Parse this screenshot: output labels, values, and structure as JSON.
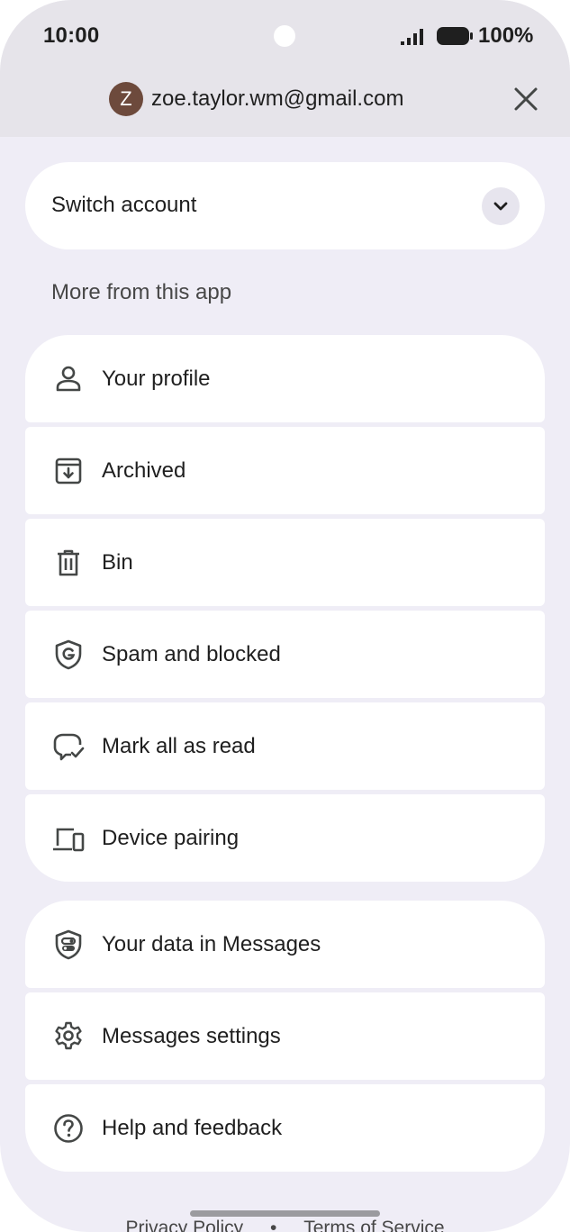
{
  "status_bar": {
    "time": "10:00",
    "battery_percent": "100%",
    "signal_icon": "cellular-signal-icon",
    "battery_icon": "battery-full-icon"
  },
  "account": {
    "avatar_initial": "Z",
    "avatar_color": "#6d4a3c",
    "email": "zoe.taylor.wm@gmail.com",
    "close_icon": "close-icon"
  },
  "switch_account": {
    "label": "Switch account",
    "icon": "chevron-down-icon"
  },
  "section_label": "More from this app",
  "menu_group_1": [
    {
      "label": "Your profile",
      "icon": "person-icon"
    },
    {
      "label": "Archived",
      "icon": "archive-icon"
    },
    {
      "label": "Bin",
      "icon": "trash-icon"
    },
    {
      "label": "Spam and blocked",
      "icon": "shield-g-icon"
    },
    {
      "label": "Mark all as read",
      "icon": "chat-check-icon"
    },
    {
      "label": "Device pairing",
      "icon": "devices-icon"
    }
  ],
  "menu_group_2": [
    {
      "label": "Your data in Messages",
      "icon": "shield-toggle-icon"
    },
    {
      "label": "Messages settings",
      "icon": "gear-icon"
    },
    {
      "label": "Help and feedback",
      "icon": "help-icon"
    }
  ],
  "footer": {
    "privacy": "Privacy Policy",
    "separator": "•",
    "terms": "Terms of Service"
  },
  "colors": {
    "background": "#efedf6",
    "header": "#e6e4ea",
    "card": "#ffffff",
    "text": "#1f1f1f"
  }
}
